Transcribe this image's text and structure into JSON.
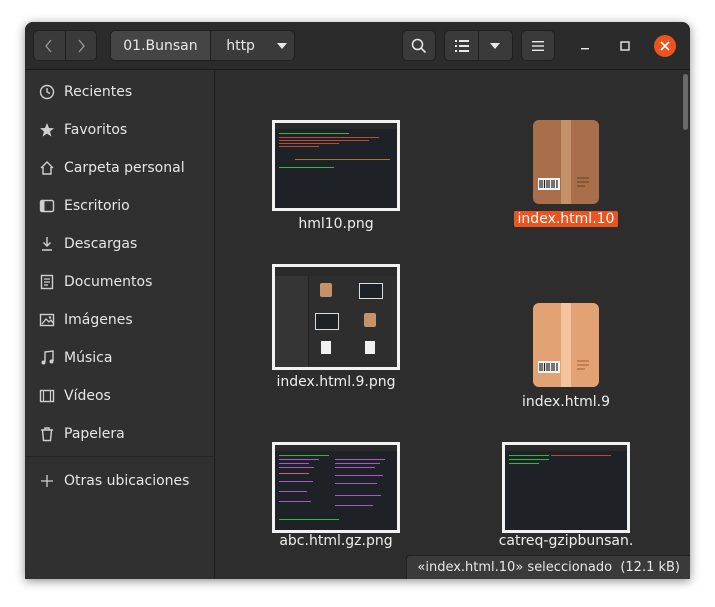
{
  "header": {
    "path_segments": [
      "01.Bunsan",
      "http"
    ],
    "icons": {
      "back": "chevron-left-icon",
      "forward": "chevron-right-icon",
      "search": "search-icon",
      "view": "list-view-icon",
      "view_menu": "chevron-down-icon",
      "menu": "hamburger-menu-icon",
      "minimize": "minimize-icon",
      "maximize": "maximize-icon",
      "close": "close-icon"
    }
  },
  "sidebar": {
    "items": [
      {
        "label": "Recientes",
        "icon": "clock-icon"
      },
      {
        "label": "Favoritos",
        "icon": "star-icon"
      },
      {
        "label": "Carpeta personal",
        "icon": "home-icon"
      },
      {
        "label": "Escritorio",
        "icon": "desktop-icon"
      },
      {
        "label": "Descargas",
        "icon": "download-icon"
      },
      {
        "label": "Documentos",
        "icon": "document-icon"
      },
      {
        "label": "Imágenes",
        "icon": "image-icon"
      },
      {
        "label": "Música",
        "icon": "music-icon"
      },
      {
        "label": "Vídeos",
        "icon": "video-icon"
      },
      {
        "label": "Papelera",
        "icon": "trash-icon"
      }
    ],
    "other_locations": {
      "label": "Otras ubicaciones",
      "icon": "plus-icon"
    }
  },
  "files": [
    {
      "name": "hml10.png",
      "type": "image",
      "selected": false
    },
    {
      "name": "index.html.10",
      "type": "package",
      "selected": true
    },
    {
      "name": "index.html.9.png",
      "type": "image",
      "selected": false
    },
    {
      "name": "index.html.9",
      "type": "package",
      "selected": false
    },
    {
      "name": "abc.html.gz.png",
      "type": "image",
      "selected": false
    },
    {
      "name": "catreq-gzipbunsan.",
      "type": "image",
      "selected": false
    }
  ],
  "status": {
    "text": "«index.html.10» seleccionado  (12.1 kB)"
  },
  "colors": {
    "accent": "#e95420",
    "window_bg": "#2d2d2d",
    "sidebar_bg": "#303030"
  }
}
